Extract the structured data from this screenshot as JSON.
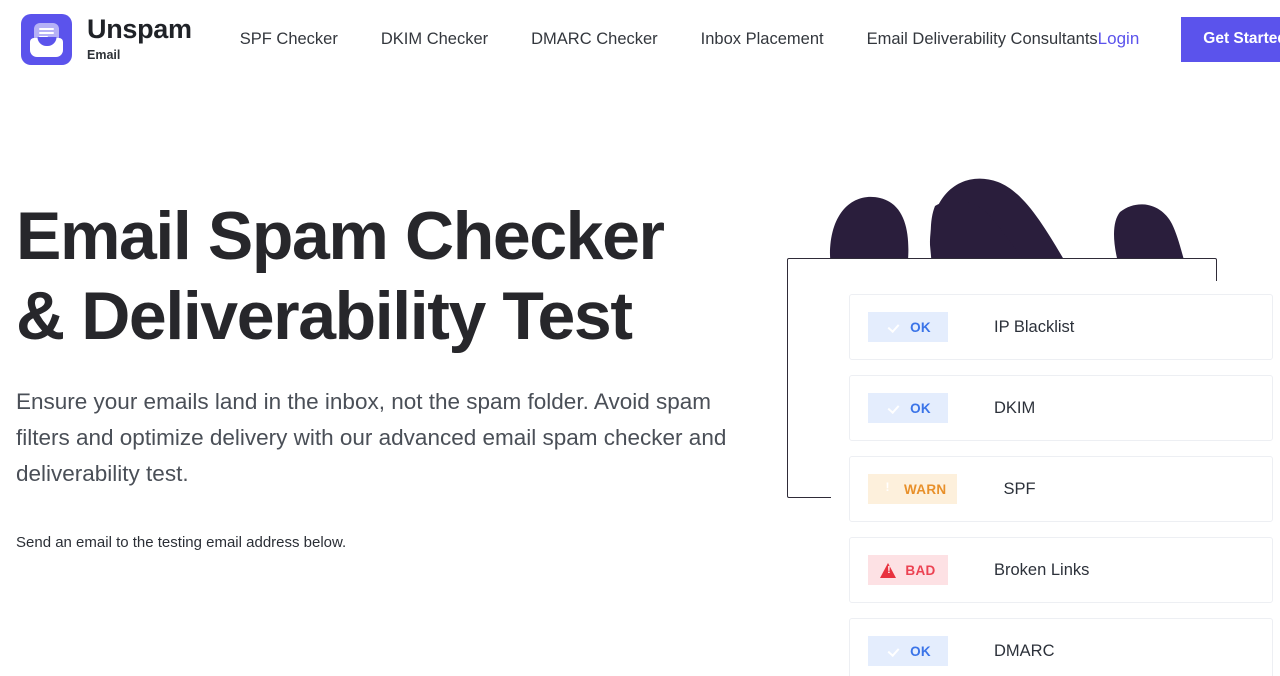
{
  "header": {
    "brand": {
      "name": "Unspam",
      "subtitle": "Email",
      "logo_icon": "inbox-message-icon",
      "logo_color": "#5b53ec"
    },
    "nav_items": [
      {
        "label": "SPF Checker"
      },
      {
        "label": "DKIM Checker"
      },
      {
        "label": "DMARC Checker"
      },
      {
        "label": "Inbox Placement"
      },
      {
        "label": "Email Deliverability Consultants"
      }
    ],
    "login_label": "Login",
    "cta_label": "Get Started",
    "accent_color": "#5b53ec"
  },
  "hero": {
    "title": "Email Spam Checker & Deliverability Test",
    "subtitle": "Ensure your emails land in the inbox, not the spam folder. Avoid spam filters and optimize delivery with our advanced email spam checker and deliverability test.",
    "note": "Send an email to the testing email address below."
  },
  "illustration": {
    "result_rows": [
      {
        "status": "OK",
        "status_type": "ok",
        "icon": "check-circle-icon",
        "label": "IP Blacklist"
      },
      {
        "status": "OK",
        "status_type": "ok",
        "icon": "check-circle-icon",
        "label": "DKIM"
      },
      {
        "status": "WARN",
        "status_type": "warn",
        "icon": "exclamation-circle-icon",
        "label": "SPF"
      },
      {
        "status": "BAD",
        "status_type": "bad",
        "icon": "warning-triangle-icon",
        "label": "Broken Links"
      },
      {
        "status": "OK",
        "status_type": "ok",
        "icon": "check-circle-icon",
        "label": "DMARC"
      }
    ],
    "status_colors": {
      "ok_bg": "#e4edfd",
      "ok_fg": "#3b74e8",
      "ok_icon": "#3b8ef0",
      "warn_bg": "#fdf0dc",
      "warn_fg": "#e8902a",
      "warn_icon": "#f08c24",
      "bad_bg": "#fde1e4",
      "bad_fg": "#ec4252",
      "bad_icon": "#e8323f"
    },
    "blob_color": "#2a1e3c"
  }
}
